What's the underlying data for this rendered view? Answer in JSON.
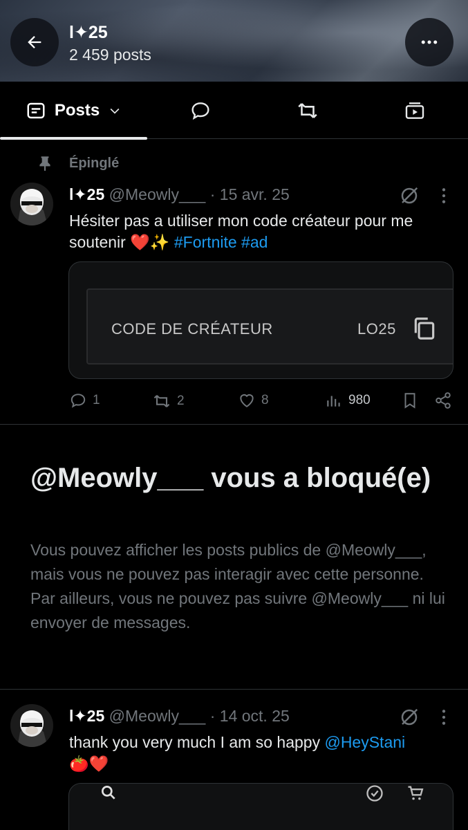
{
  "header": {
    "title": "l✦25",
    "post_count": "2 459 posts"
  },
  "tabs": [
    {
      "label": "Posts"
    }
  ],
  "pinned_label": "Épinglé",
  "post1": {
    "name": "l✦25",
    "handle": "@Meowly___",
    "dot": "·",
    "date": "15 avr. 25",
    "text": "Hésiter pas a utiliser mon code créateur pour me soutenir ❤️✨ ",
    "hashtag1": "#Fortnite",
    "hashtag2": "#ad",
    "card": {
      "code_label": "CODE DE CRÉATEUR",
      "code_value": "LO25"
    },
    "actions": {
      "replies": "1",
      "reposts": "2",
      "likes": "8",
      "views": "980"
    }
  },
  "blocked": {
    "title": "@Meowly___ vous a bloqué(e)",
    "description": "Vous pouvez afficher les posts publics de @Meowly___, mais vous ne pouvez pas interagir avec cette personne. Par ailleurs, vous ne pouvez pas suivre @Meowly___ ni lui envoyer de messages."
  },
  "post2": {
    "name": "l✦25",
    "handle": "@Meowly___",
    "dot": "·",
    "date": "14 oct. 25",
    "text": "thank you very much I am so happy ",
    "mention": "@HeyStani",
    "emoji": "🍅❤️"
  },
  "icons": {
    "back": "arrow-left-icon",
    "more": "more-horizontal-icon",
    "posts_tab": "posts-tab-icon",
    "replies_tab": "reply-icon",
    "reposts_tab": "repost-icon",
    "media_tab": "media-icon",
    "pin": "pin-icon",
    "grok": "grok-icon",
    "search": "search-icon",
    "cart": "cart-icon"
  },
  "colors": {
    "background": "#000000",
    "text_primary": "#e7e9ea",
    "text_secondary": "#71767b",
    "link": "#1d9bf0",
    "border": "#2f3336"
  }
}
